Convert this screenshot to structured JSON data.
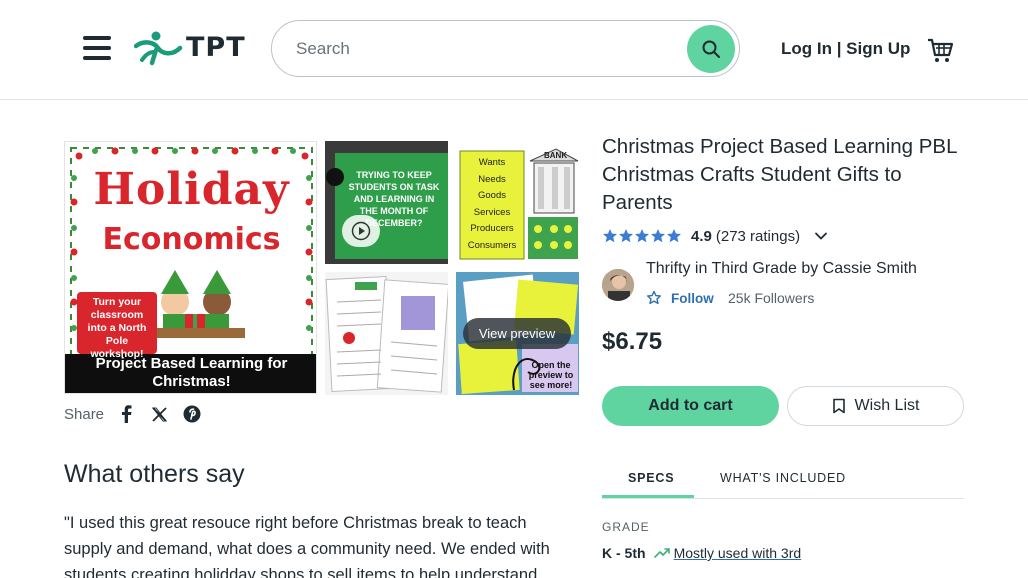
{
  "header": {
    "logo_text": "TPT",
    "search_placeholder": "Search",
    "login_label": "Log In | Sign Up",
    "menu_icon": "hamburger-menu-icon",
    "cart_icon": "shopping-cart-icon",
    "search_icon": "magnifier-icon"
  },
  "gallery": {
    "main_image": {
      "title_line1": "Holiday",
      "title_line2": "Economics",
      "tagline": "Turn your classroom into a North Pole workshop!",
      "banner": "Project Based Learning for Christmas!"
    },
    "thumb_video_text": "TRYING TO KEEP STUDENTS ON TASK AND LEARNING IN THE MONTH OF DECEMBER?",
    "thumb_words": [
      "Wants",
      "Needs",
      "Goods",
      "Services",
      "Producers",
      "Consumers"
    ],
    "thumb_bank": "BANK",
    "thumb_preview_note": "Open the preview to see more!",
    "view_preview_label": "View preview"
  },
  "share": {
    "label": "Share",
    "icons": [
      "facebook-icon",
      "x-icon",
      "pinterest-icon"
    ]
  },
  "reviews": {
    "heading": "What others say",
    "quote": "\"I used this great resouce right before Christmas break to teach supply and demand, what does a community need. We ended with students creating holidday shops to sell items to help understand"
  },
  "product": {
    "title": "Christmas Project Based Learning PBL Christmas Crafts Student Gifts to Parents",
    "rating": "4.9",
    "rating_count": "(273 ratings)",
    "stars": 5,
    "seller": "Thrifty in Third Grade by Cassie Smith",
    "follow_label": "Follow",
    "followers": "25k Followers",
    "price": "$6.75",
    "add_to_cart_label": "Add to cart",
    "wish_list_label": "Wish List"
  },
  "tabs": {
    "specs": "SPECS",
    "included": "WHAT'S INCLUDED"
  },
  "specs": {
    "grade_label": "GRADE",
    "grade_value": "K - 5th",
    "grade_note": "Mostly used with 3rd"
  },
  "colors": {
    "brand_green": "#5fd3a0",
    "link_blue": "#2e6fb3",
    "star_blue": "#3b7bd4",
    "text": "#1f2b33"
  }
}
